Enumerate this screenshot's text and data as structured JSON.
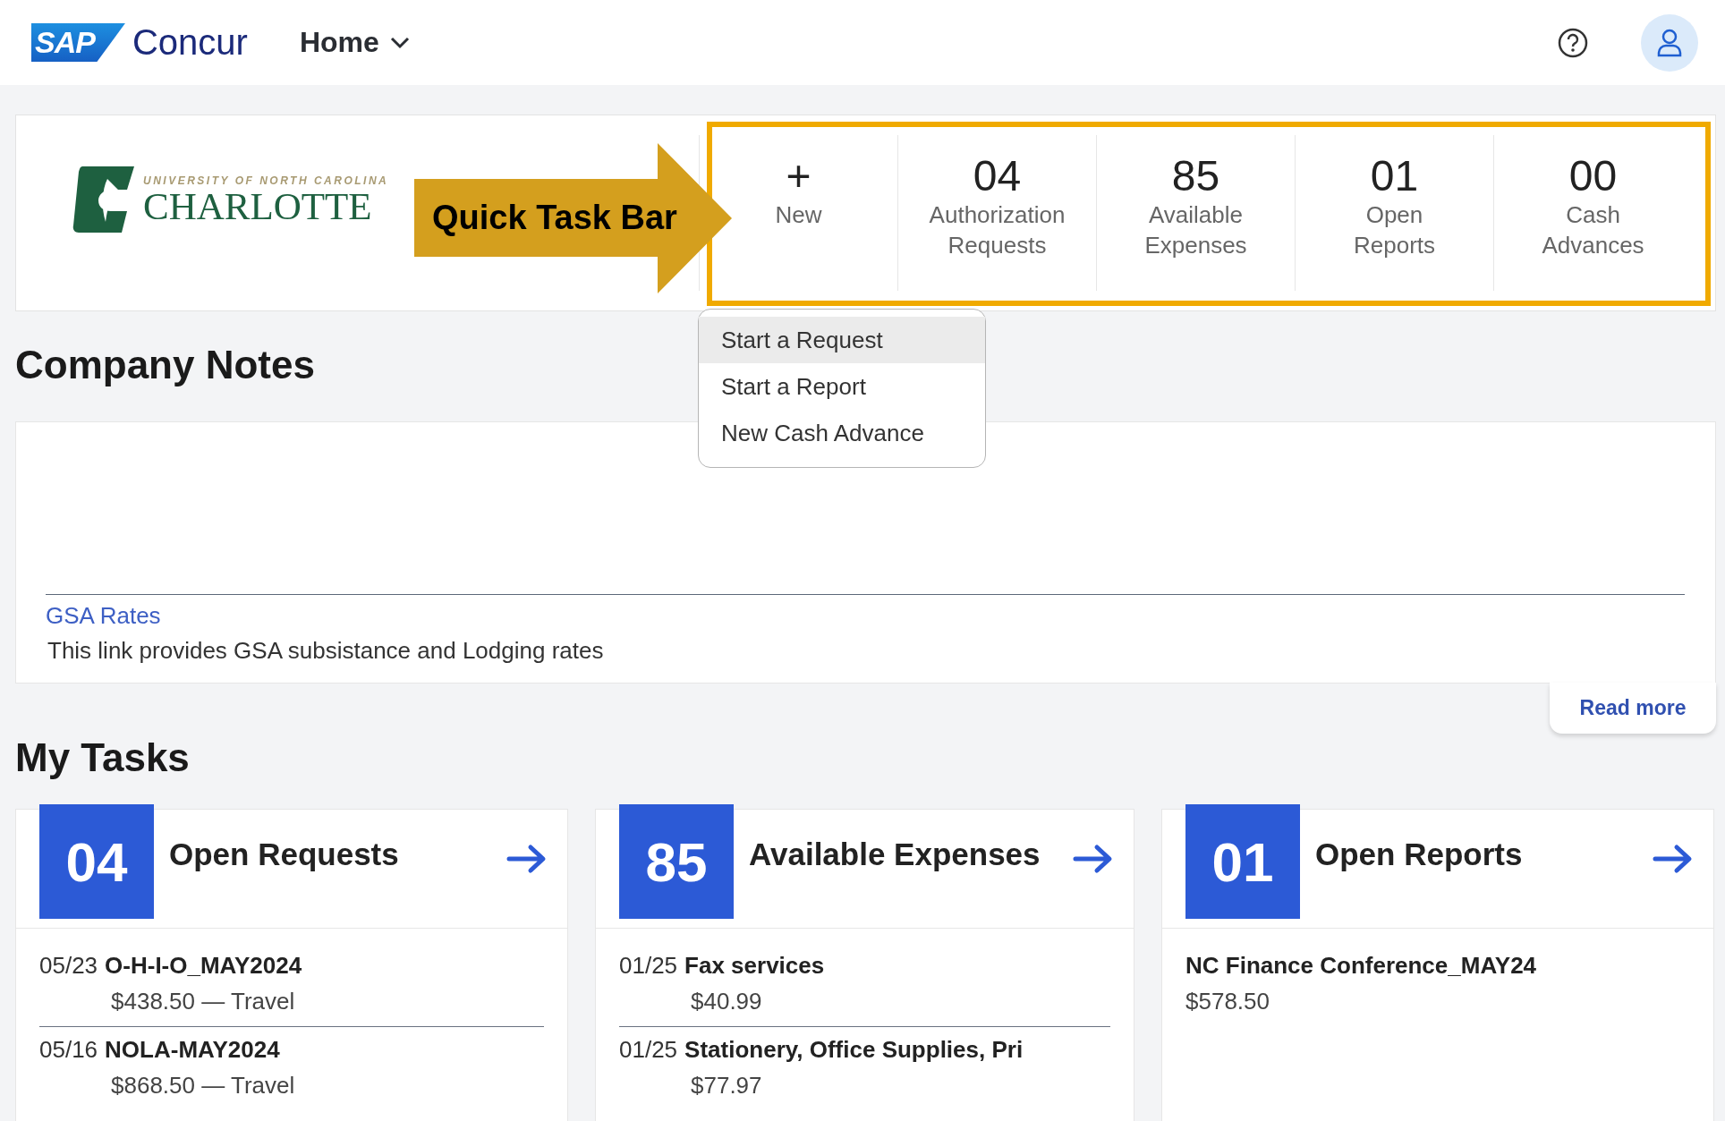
{
  "header": {
    "brand": {
      "mark": "SAP",
      "name": "Concur"
    },
    "nav": {
      "label": "Home"
    }
  },
  "banner": {
    "org_logo": {
      "tagline": "UNIVERSITY OF NORTH CAROLINA",
      "name": "CHARLOTTE"
    },
    "quick_tasks": [
      {
        "kind": "new",
        "icon": "+",
        "label": "New"
      },
      {
        "kind": "count",
        "count": "04",
        "label": "Authorization Requests"
      },
      {
        "kind": "count",
        "count": "85",
        "label": "Available Expenses"
      },
      {
        "kind": "count",
        "count": "01",
        "label": "Open Reports"
      },
      {
        "kind": "count",
        "count": "00",
        "label": "Cash Advances"
      }
    ]
  },
  "annotation": {
    "text": "Quick Task Bar"
  },
  "new_menu": {
    "items": [
      {
        "label": "Start a Request",
        "selected": true
      },
      {
        "label": "Start a Report",
        "selected": false
      },
      {
        "label": "New Cash Advance",
        "selected": false
      }
    ]
  },
  "company_notes": {
    "title": "Company Notes",
    "link": "GSA Rates",
    "description": "This link provides GSA subsistance and Lodging rates",
    "read_more": "Read more"
  },
  "my_tasks": {
    "title": "My Tasks",
    "cards": [
      {
        "count": "04",
        "title": "Open Requests",
        "items": [
          {
            "date": "05/23",
            "name": "O-H-I-O_MAY2024",
            "detail": "$438.50 — Travel"
          },
          {
            "date": "05/16",
            "name": "NOLA-MAY2024",
            "detail": "$868.50 — Travel"
          }
        ]
      },
      {
        "count": "85",
        "title": "Available Expenses",
        "items": [
          {
            "date": "01/25",
            "name": "Fax services",
            "detail": "$40.99"
          },
          {
            "date": "01/25",
            "name": "Stationery, Office Supplies, Pri",
            "detail": "$77.97"
          }
        ]
      },
      {
        "count": "01",
        "title": "Open Reports",
        "items": [
          {
            "name": "NC Finance Conference_MAY24",
            "detail": "$578.50"
          }
        ]
      }
    ]
  }
}
